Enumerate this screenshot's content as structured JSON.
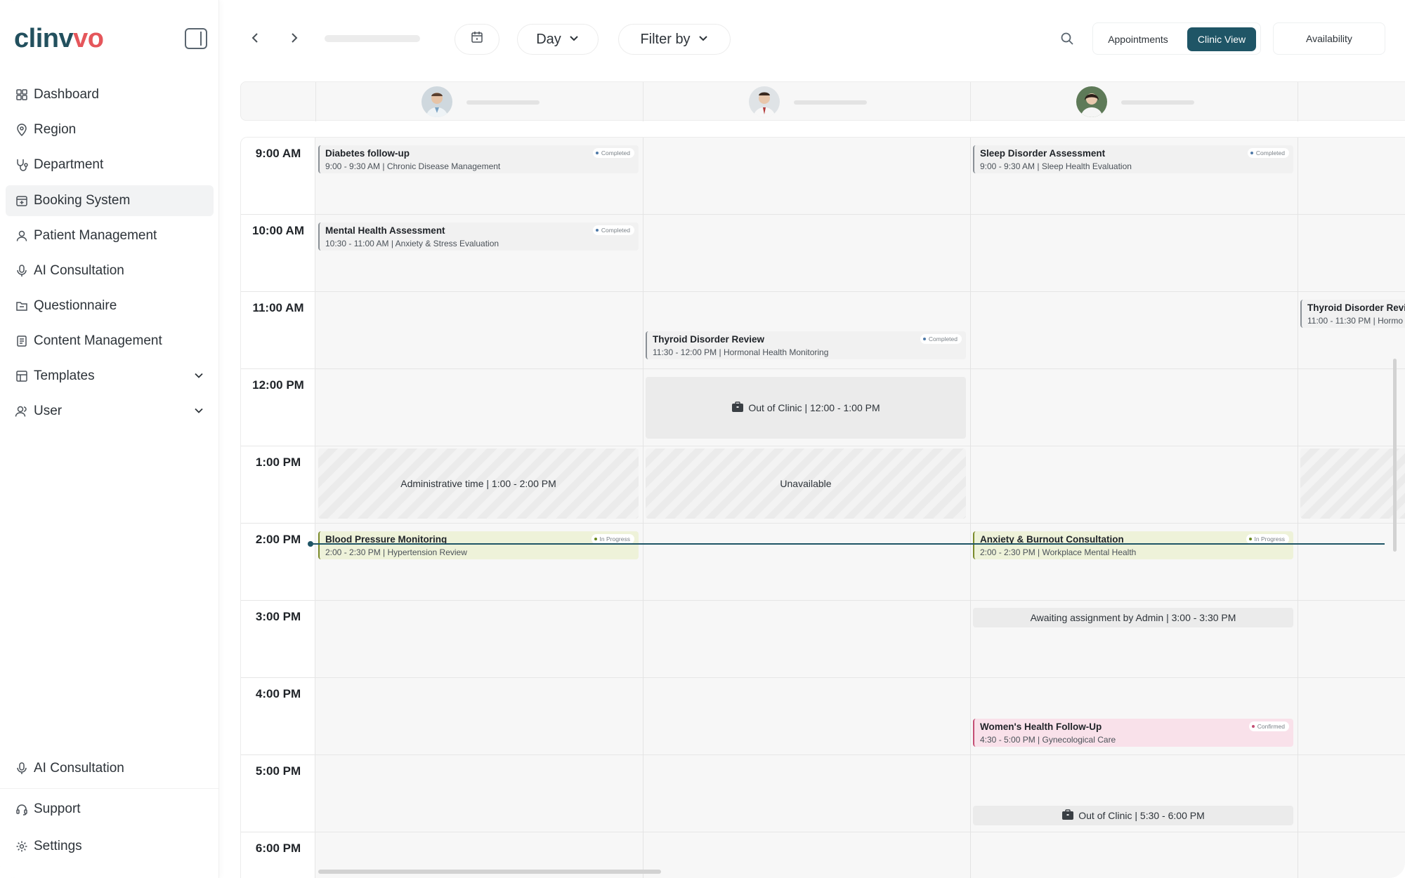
{
  "brand": {
    "logo_main": "clinv",
    "logo_accent": "vo",
    "brand_color": "#22505e",
    "accent_color": "#e5565b"
  },
  "sidebar": {
    "items": [
      {
        "label": "Dashboard",
        "icon": "dashboard-icon"
      },
      {
        "label": "Region",
        "icon": "location-pin-icon"
      },
      {
        "label": "Department",
        "icon": "stethoscope-icon"
      },
      {
        "label": "Booking System",
        "icon": "calendar-plus-icon",
        "active": true
      },
      {
        "label": "Patient Management",
        "icon": "user-icon"
      },
      {
        "label": "AI Consultation",
        "icon": "microphone-icon"
      },
      {
        "label": "Questionnaire",
        "icon": "folder-icon"
      },
      {
        "label": "Content Management",
        "icon": "document-icon"
      },
      {
        "label": "Templates",
        "icon": "table-icon",
        "expandable": true
      },
      {
        "label": "User",
        "icon": "users-icon",
        "expandable": true
      }
    ],
    "bottom_items": [
      {
        "label": "AI Consultation",
        "icon": "microphone-icon"
      },
      {
        "label": "Support",
        "icon": "headset-icon"
      },
      {
        "label": "Settings",
        "icon": "gear-icon"
      }
    ]
  },
  "toolbar": {
    "view_select": "Day",
    "filter_label": "Filter by",
    "segment": {
      "appointments": "Appointments",
      "clinic_view": "Clinic View",
      "active": "Clinic View"
    },
    "availability": "Availability"
  },
  "calendar": {
    "times": [
      "9:00 AM",
      "10:00 AM",
      "11:00 AM",
      "12:00 PM",
      "1:00 PM",
      "2:00 PM",
      "3:00 PM",
      "4:00 PM",
      "5:00 PM",
      "6:00 PM"
    ],
    "events": {
      "e1": {
        "title": "Diabetes follow-up",
        "time": "9:00 - 9:30 AM",
        "detail": "Chronic Disease Management",
        "status": "Completed"
      },
      "e2": {
        "title": "Mental Health Assessment",
        "time": "10:30 - 11:00 AM",
        "detail": "Anxiety & Stress Evaluation",
        "status": "Completed"
      },
      "e3": {
        "title": "Blood Pressure Monitoring",
        "time": "2:00 - 2:30 PM",
        "detail": "Hypertension Review",
        "status": "In Progress"
      },
      "e4": {
        "title": "Thyroid Disorder Review",
        "time": "11:30 - 12:00 PM",
        "detail": "Hormonal Health Monitoring",
        "status": "Completed"
      },
      "e5": {
        "title": "Sleep Disorder Assessment",
        "time": "9:00 - 9:30 AM",
        "detail": "Sleep Health Evaluation",
        "status": "Completed"
      },
      "e6": {
        "title": "Anxiety & Burnout Consultation",
        "time": "2:00 - 2:30 PM",
        "detail": "Workplace Mental Health",
        "status": "In Progress"
      },
      "e7": {
        "title": "Women's Health Follow-Up",
        "time": "4:30 - 5:00 PM",
        "detail": "Gynecological Care",
        "status": "Confirmed"
      },
      "e8": {
        "title": "Thyroid Disorder Revie",
        "time": "11:00 - 11:30 PM",
        "detail": "Hormo"
      }
    },
    "blocks": {
      "admin": "Administrative time | 1:00 - 2:00 PM",
      "ooc1": "Out of Clinic | 12:00 - 1:00 PM",
      "unavailable": "Unavailable",
      "awaiting": "Awaiting assignment by Admin | 3:00 - 3:30 PM",
      "ooc2": "Out of Clinic | 5:30 - 6:00 PM"
    },
    "colors": {
      "completed": "#f1f1f1",
      "in_progress": "#eef2d9",
      "confirmed": "#f9e1ea",
      "now_line": "#1f5566"
    }
  }
}
